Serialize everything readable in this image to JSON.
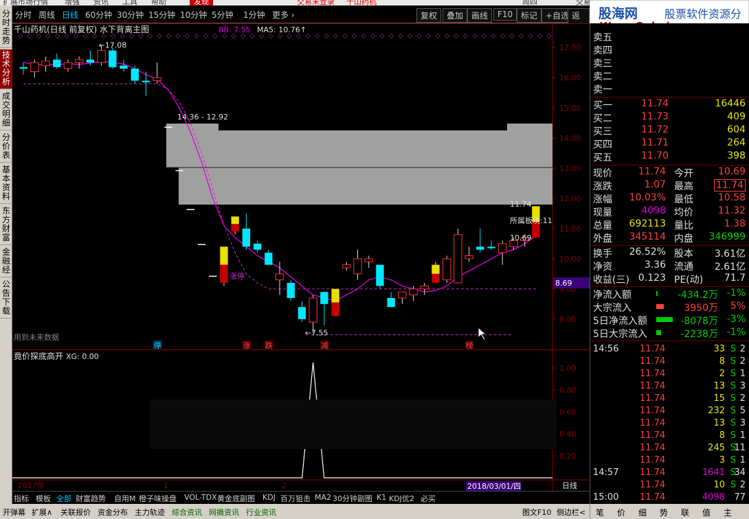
{
  "menubar": [
    "扩展市场行情",
    "增强",
    "资讯",
    "工具",
    "帮助",
    "发现",
    "交易未登录",
    "千山药机",
    "周四",
    "交易"
  ],
  "left_nav": [
    "分时走势",
    "技术分析",
    "成交明细",
    "分价表",
    "基本资料",
    "东方财富",
    "金融经",
    "公告下载"
  ],
  "left_nav_active": 1,
  "periods": [
    "分时",
    "周线",
    "日线",
    "60分钟",
    "30分钟",
    "15分钟",
    "10分钟",
    "5分钟",
    "1分钟",
    "更多 ›"
  ],
  "period_selected": 2,
  "toolbar_right": [
    "复权",
    "叠加",
    "画线",
    "F10",
    "标记",
    "+自选",
    "返回"
  ],
  "chart": {
    "title": "千山药机(日线 前复权) 水下背离主图",
    "bb": "BB: 7.55",
    "ma5": "MA5: 10.76↑",
    "high_label": "17.08",
    "low_label": "7.55",
    "range_label": "14.36 - 12.92",
    "right_price_label": "11.74",
    "right_price_label2": "10.69",
    "sector_label": "所属板块:11",
    "limit_label": "涨停",
    "note": "用到未来数据",
    "current_price_tag": "8.69",
    "markers": [
      "停",
      "涨",
      "跌",
      "减",
      "榜"
    ],
    "y_ticks": [
      "17.00",
      "16.00",
      "15.00",
      "14.00",
      "13.00",
      "12.00",
      "11.00",
      "10.00",
      "9.00",
      "8.00"
    ]
  },
  "chart_data": {
    "type": "candlestick",
    "title": "千山药机(日线 前复权) 水下背离主图",
    "ylim": [
      7.2,
      17.3
    ],
    "candles": [
      {
        "o": 16.3,
        "h": 16.5,
        "l": 16.1,
        "c": 16.35,
        "up": false
      },
      {
        "o": 16.2,
        "h": 16.6,
        "l": 16.0,
        "c": 16.5,
        "up": true
      },
      {
        "o": 16.4,
        "h": 16.7,
        "l": 16.2,
        "c": 16.55,
        "up": true
      },
      {
        "o": 16.6,
        "h": 16.8,
        "l": 16.3,
        "c": 16.35,
        "up": false
      },
      {
        "o": 16.3,
        "h": 16.6,
        "l": 16.2,
        "c": 16.5,
        "up": true
      },
      {
        "o": 16.5,
        "h": 16.7,
        "l": 16.3,
        "c": 16.6,
        "up": true
      },
      {
        "o": 16.6,
        "h": 16.9,
        "l": 16.4,
        "c": 16.5,
        "up": false
      },
      {
        "o": 16.5,
        "h": 17.08,
        "l": 16.4,
        "c": 16.9,
        "up": true
      },
      {
        "o": 16.9,
        "h": 17.0,
        "l": 16.3,
        "c": 16.35,
        "up": false
      },
      {
        "o": 16.4,
        "h": 16.6,
        "l": 16.2,
        "c": 16.3,
        "up": false
      },
      {
        "o": 16.3,
        "h": 16.4,
        "l": 15.8,
        "c": 15.9,
        "up": false
      },
      {
        "o": 15.9,
        "h": 16.2,
        "l": 15.4,
        "c": 15.85,
        "up": false
      },
      {
        "o": 15.9,
        "h": 16.5,
        "l": 15.8,
        "c": 16.0,
        "up": true
      },
      {
        "o": 14.36,
        "h": 14.36,
        "l": 14.36,
        "c": 14.36,
        "up": false
      },
      {
        "o": 12.92,
        "h": 12.92,
        "l": 12.92,
        "c": 12.92,
        "up": false
      },
      {
        "o": 11.63,
        "h": 11.63,
        "l": 11.63,
        "c": 11.63,
        "up": false
      },
      {
        "o": 10.47,
        "h": 10.47,
        "l": 10.47,
        "c": 10.47,
        "up": false
      },
      {
        "o": 9.42,
        "h": 9.42,
        "l": 9.42,
        "c": 9.42,
        "up": false
      },
      {
        "o": 9.2,
        "h": 10.4,
        "l": 9.1,
        "c": 10.4,
        "up": true
      },
      {
        "o": 11.4,
        "h": 11.4,
        "l": 10.8,
        "c": 10.9,
        "up": true
      },
      {
        "o": 11.0,
        "h": 11.5,
        "l": 10.3,
        "c": 10.4,
        "up": false
      },
      {
        "o": 10.5,
        "h": 10.6,
        "l": 10.2,
        "c": 10.3,
        "up": false
      },
      {
        "o": 10.2,
        "h": 10.3,
        "l": 9.8,
        "c": 9.8,
        "up": false
      },
      {
        "o": 9.5,
        "h": 9.9,
        "l": 8.8,
        "c": 9.3,
        "up": true
      },
      {
        "o": 9.2,
        "h": 9.3,
        "l": 8.6,
        "c": 8.7,
        "up": false
      },
      {
        "o": 8.4,
        "h": 8.6,
        "l": 7.9,
        "c": 8.0,
        "up": false
      },
      {
        "o": 7.9,
        "h": 8.8,
        "l": 7.55,
        "c": 8.7,
        "up": true
      },
      {
        "o": 8.5,
        "h": 8.9,
        "l": 7.8,
        "c": 8.9,
        "up": false
      },
      {
        "o": 8.1,
        "h": 9.0,
        "l": 8.1,
        "c": 9.0,
        "up": true
      },
      {
        "o": 9.8,
        "h": 9.9,
        "l": 9.6,
        "c": 9.7,
        "up": true
      },
      {
        "o": 9.5,
        "h": 10.3,
        "l": 9.3,
        "c": 10.0,
        "up": true
      },
      {
        "o": 9.9,
        "h": 10.1,
        "l": 9.7,
        "c": 10.0,
        "up": true
      },
      {
        "o": 9.8,
        "h": 9.8,
        "l": 9.0,
        "c": 9.1,
        "up": false
      },
      {
        "o": 8.7,
        "h": 8.9,
        "l": 8.4,
        "c": 8.4,
        "up": false
      },
      {
        "o": 8.7,
        "h": 8.9,
        "l": 8.5,
        "c": 8.9,
        "up": true
      },
      {
        "o": 8.8,
        "h": 9.1,
        "l": 8.6,
        "c": 9.0,
        "up": true
      },
      {
        "o": 9.0,
        "h": 9.2,
        "l": 8.8,
        "c": 9.1,
        "up": true
      },
      {
        "o": 9.8,
        "h": 9.9,
        "l": 9.2,
        "c": 9.2,
        "up": true
      },
      {
        "o": 9.3,
        "h": 10.1,
        "l": 9.2,
        "c": 10.0,
        "up": true
      },
      {
        "o": 9.2,
        "h": 11.0,
        "l": 9.2,
        "c": 10.8,
        "up": true
      },
      {
        "o": 10.0,
        "h": 10.4,
        "l": 9.9,
        "c": 10.1,
        "up": true
      },
      {
        "o": 10.3,
        "h": 11.0,
        "l": 10.2,
        "c": 10.4,
        "up": false
      },
      {
        "o": 10.4,
        "h": 10.6,
        "l": 10.3,
        "c": 10.35,
        "up": false
      },
      {
        "o": 10.5,
        "h": 10.6,
        "l": 9.8,
        "c": 10.2,
        "up": true
      },
      {
        "o": 10.4,
        "h": 10.7,
        "l": 10.3,
        "c": 10.6,
        "up": true
      },
      {
        "o": 10.6,
        "h": 10.8,
        "l": 10.4,
        "c": 10.7,
        "up": true
      },
      {
        "o": 10.7,
        "h": 11.74,
        "l": 10.69,
        "c": 11.74,
        "up": true
      }
    ],
    "ma5": [
      16.5,
      16.45,
      16.42,
      16.44,
      16.46,
      16.44,
      16.48,
      16.55,
      16.5,
      16.45,
      16.3,
      16.1,
      15.95,
      15.6,
      15.0,
      14.2,
      13.2,
      12.0,
      11.1,
      10.7,
      10.4,
      10.1,
      9.9,
      9.7,
      9.4,
      9.1,
      8.8,
      8.7,
      8.6,
      8.8,
      9.0,
      9.3,
      9.4,
      9.3,
      9.1,
      9.0,
      8.9,
      8.95,
      9.1,
      9.4,
      9.6,
      9.8,
      10.0,
      10.2,
      10.3,
      10.5,
      10.76
    ],
    "bb": [
      15.8,
      15.8,
      15.8,
      15.8,
      15.8,
      15.8,
      15.8,
      15.8,
      15.8,
      15.8,
      15.8,
      15.8,
      15.8,
      15.6,
      15.2,
      14.5,
      13.5,
      12.3,
      11.1,
      10.2,
      9.5,
      9.2,
      9.0,
      9.0,
      9.0,
      9.0,
      9.0,
      9.0,
      9.0,
      9.0,
      9.0,
      9.0,
      9.0,
      9.0,
      9.0,
      9.0,
      9.0,
      9.0,
      9.0,
      9.0,
      9.0,
      9.0,
      9.0,
      9.0,
      9.0,
      9.0,
      9.0
    ]
  },
  "indicator": {
    "title": "竟价探底高开",
    "xg": "XG: 0.00",
    "y_ticks": [
      "1.00",
      "0.80",
      "0.60",
      "0.40",
      "0.20"
    ],
    "spike_index": 26,
    "year_label": "2017年",
    "m1": "1",
    "m2": "2",
    "date": "2018/03/01/四",
    "period": "日线"
  },
  "tabs1": [
    "指标",
    "模板",
    "全部",
    "财富趋势",
    "自用M",
    "橙子味操盘",
    "VOL-TDX",
    "黄金底副图",
    "KDJ",
    "百万狙击",
    "MA2",
    "30分钟副图",
    "K1",
    "KDJ优2",
    "必买"
  ],
  "tabs1_selected": 2,
  "tabs2": [
    "开弹幕",
    "扩展∧",
    "关联报价",
    "资金分布",
    "主力轨迹",
    "综合资讯",
    "网摘资讯",
    "行业资讯"
  ],
  "tabs2_green": [
    5,
    6,
    7
  ],
  "tabs2_right": [
    "图文F10",
    "侧边栏<"
  ],
  "banner": {
    "title": "股海网",
    "subtitle": "股票软件资源分享",
    "url": "Www.Guhai.com.cn"
  },
  "sell": [
    {
      "label": "卖五",
      "price": "",
      "vol": ""
    },
    {
      "label": "卖四",
      "price": "",
      "vol": ""
    },
    {
      "label": "卖三",
      "price": "",
      "vol": ""
    },
    {
      "label": "卖二",
      "price": "",
      "vol": ""
    },
    {
      "label": "卖一",
      "price": "",
      "vol": ""
    }
  ],
  "buy": [
    {
      "label": "买一",
      "price": "11.74",
      "vol": "16446"
    },
    {
      "label": "买二",
      "price": "11.73",
      "vol": "409"
    },
    {
      "label": "买三",
      "price": "11.72",
      "vol": "604"
    },
    {
      "label": "买四",
      "price": "11.71",
      "vol": "264"
    },
    {
      "label": "买五",
      "price": "11.70",
      "vol": "398"
    }
  ],
  "stats": [
    {
      "l1": "现价",
      "v1": "11.74",
      "c1": "#ff4040",
      "l2": "今开",
      "v2": "10.69",
      "c2": "#ff4040"
    },
    {
      "l1": "涨跌",
      "v1": "1.07",
      "c1": "#ff4040",
      "l2": "最高",
      "v2": "11.74",
      "c2": "#ff4040"
    },
    {
      "l1": "涨幅",
      "v1": "10.03%",
      "c1": "#ff4040",
      "l2": "最低",
      "v2": "10.58",
      "c2": "#ff4040"
    },
    {
      "l1": "现量",
      "v1": "4098",
      "c1": "#e000e0",
      "l2": "均价",
      "v2": "11.32",
      "c2": "#ff4040"
    },
    {
      "l1": "总量",
      "v1": "692113",
      "c1": "#e8e800",
      "l2": "量比",
      "v2": "1.38",
      "c2": "#ff4040"
    },
    {
      "l1": "外盘",
      "v1": "345114",
      "c1": "#ff4040",
      "l2": "内盘",
      "v2": "346999",
      "c2": "#00d000"
    },
    {
      "l1": "换手",
      "v1": "26.52%",
      "c1": "#e0e0e0",
      "l2": "股本",
      "v2": "3.61亿",
      "c2": "#e0e0e0"
    },
    {
      "l1": "净资",
      "v1": "3.36",
      "c1": "#e0e0e0",
      "l2": "流通",
      "v2": "2.61亿",
      "c2": "#e0e0e0"
    },
    {
      "l1": "收益(三)",
      "v1": "0.123",
      "c1": "#e0e0e0",
      "l2": "PE(动)",
      "v2": "71.7",
      "c2": "#e0e0e0"
    }
  ],
  "flows": [
    {
      "label": "净流入额",
      "value": "-434.2万",
      "pct": "-1%",
      "color": "#00d000",
      "bar": 0.05
    },
    {
      "label": "大宗流入",
      "value": "3950万",
      "pct": "5%",
      "color": "#ff4040",
      "bar": 0.25
    },
    {
      "label": "5日净流入额",
      "value": "-8078万",
      "pct": "-3%",
      "color": "#00d000",
      "bar": 0.55
    },
    {
      "label": "5日大宗流入",
      "value": "-2238万",
      "pct": "-1%",
      "color": "#00d000",
      "bar": 0.15
    }
  ],
  "ticks": [
    {
      "t": "14:56",
      "p": "11.74",
      "v": "33",
      "vc": "#e8e800",
      "s": "S",
      "n": "2"
    },
    {
      "t": "",
      "p": "11.74",
      "v": "8",
      "vc": "#e8e800",
      "s": "S",
      "n": "2"
    },
    {
      "t": "",
      "p": "11.74",
      "v": "2",
      "vc": "#e8e800",
      "s": "S",
      "n": "1"
    },
    {
      "t": "",
      "p": "11.74",
      "v": "13",
      "vc": "#e8e800",
      "s": "S",
      "n": "3"
    },
    {
      "t": "",
      "p": "11.74",
      "v": "15",
      "vc": "#e8e800",
      "s": "S",
      "n": "2"
    },
    {
      "t": "",
      "p": "11.74",
      "v": "232",
      "vc": "#e8e800",
      "s": "S",
      "n": "5"
    },
    {
      "t": "",
      "p": "11.74",
      "v": "13",
      "vc": "#e8e800",
      "s": "S",
      "n": "3"
    },
    {
      "t": "",
      "p": "11.74",
      "v": "8",
      "vc": "#e8e800",
      "s": "S",
      "n": "1"
    },
    {
      "t": "",
      "p": "11.74",
      "v": "245",
      "vc": "#e8e800",
      "s": "S",
      "n": "11"
    },
    {
      "t": "",
      "p": "11.74",
      "v": "3",
      "vc": "#e8e800",
      "s": "S",
      "n": "1"
    },
    {
      "t": "14:57",
      "p": "11.74",
      "v": "1641",
      "vc": "#e000e0",
      "s": "S",
      "n": "34"
    },
    {
      "t": "",
      "p": "11.74",
      "v": "10",
      "vc": "#e8e800",
      "s": "S",
      "n": "2"
    },
    {
      "t": "15:00",
      "p": "11.74",
      "v": "4098",
      "vc": "#e000e0",
      "s": "",
      "n": "77"
    }
  ],
  "right_tabs": [
    "笔",
    "价",
    "细",
    "势",
    "联",
    "值",
    "主"
  ]
}
